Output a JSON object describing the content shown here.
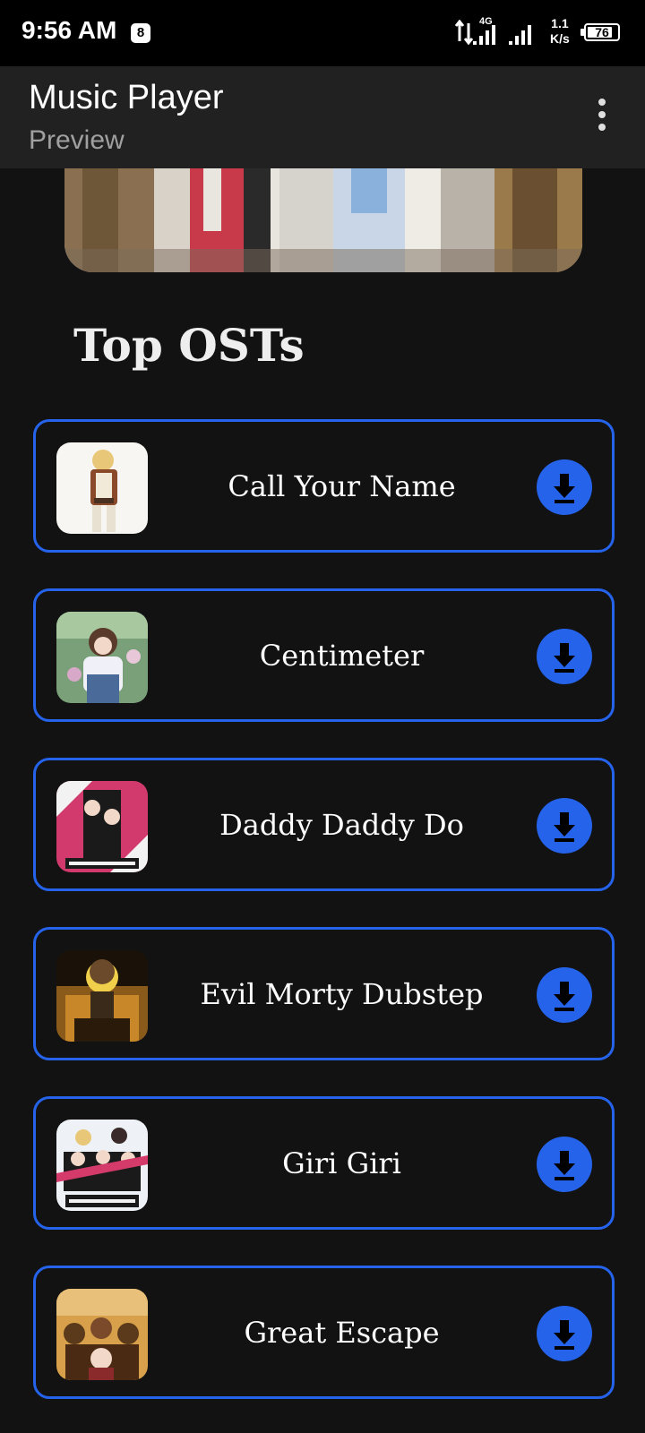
{
  "status_bar": {
    "time": "9:56 AM",
    "notification_glyph": "8",
    "network_label": "4G",
    "speed_value": "1.1",
    "speed_unit": "K/s",
    "battery_level": "76"
  },
  "app_bar": {
    "title": "Music Player",
    "subtitle": "Preview"
  },
  "section": {
    "title": "Top OSTs"
  },
  "tracks": [
    {
      "name": "Call Your Name",
      "thumb_colors": [
        "#f4f0ea",
        "#8a4a2a",
        "#d8b06a"
      ]
    },
    {
      "name": "Centimeter",
      "thumb_colors": [
        "#6a9a6c",
        "#c9a9c4",
        "#4a6b8a"
      ]
    },
    {
      "name": "Daddy Daddy Do",
      "thumb_colors": [
        "#d23a6e",
        "#1a1a1a",
        "#f2f2f2"
      ]
    },
    {
      "name": "Evil Morty Dubstep",
      "thumb_colors": [
        "#2a1a0a",
        "#c8882a",
        "#e8c24a"
      ]
    },
    {
      "name": "Giri Giri",
      "thumb_colors": [
        "#e8eef4",
        "#1a1a1a",
        "#d43a6a"
      ]
    },
    {
      "name": "Great Escape",
      "thumb_colors": [
        "#b8722a",
        "#5a3a1a",
        "#e8b45a"
      ]
    }
  ],
  "colors": {
    "accent": "#2563eb",
    "background": "#121212",
    "app_bar": "#212121"
  },
  "icons": {
    "overflow": "more-vert-icon",
    "download": "download-arrow-icon"
  }
}
